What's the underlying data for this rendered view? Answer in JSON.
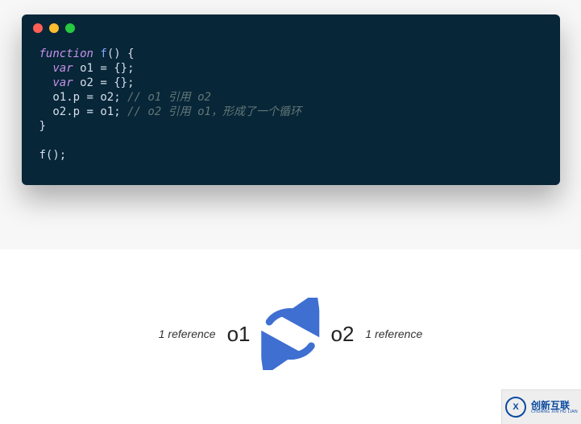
{
  "code": {
    "line1": {
      "kw": "function",
      "fn": "f",
      "open": "() {"
    },
    "line2": {
      "kw": "var",
      "id": "o1",
      "rest": " = {};"
    },
    "line3": {
      "kw": "var",
      "id": "o2",
      "rest": " = {};"
    },
    "line4": {
      "stmt": "o1.p = o2;",
      "comment": "// o1 引用 o2"
    },
    "line5": {
      "stmt": "o2.p = o1;",
      "comment": "// o2 引用 o1，形成了一个循环"
    },
    "line6": {
      "close": "}"
    },
    "line7": {
      "call": "f();"
    }
  },
  "diagram": {
    "left_ref": "1 reference",
    "node1": "o1",
    "node2": "o2",
    "right_ref": "1 reference",
    "arrow_color": "#3e6fd1"
  },
  "watermark": {
    "logo_letter": "X",
    "cn": "创新互联",
    "en": "CHUANG XIN HU LIAN"
  }
}
